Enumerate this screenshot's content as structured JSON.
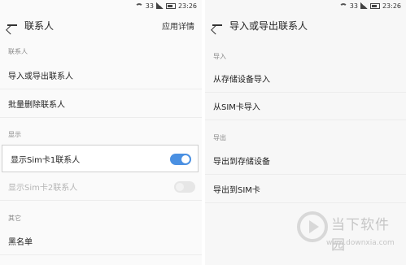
{
  "left": {
    "status": {
      "signal_text": "33",
      "time": "23:26"
    },
    "title": "联系人",
    "action": "应用详情",
    "sections": {
      "contacts": "联系人",
      "display": "显示",
      "other": "其它"
    },
    "items": {
      "import_export": "导入或导出联系人",
      "batch_delete": "批量删除联系人",
      "show_sim1": "显示Sim卡1联系人",
      "show_sim2": "显示Sim卡2联系人",
      "blacklist": "黑名单"
    },
    "toggles": {
      "show_sim1": true,
      "show_sim2": false
    }
  },
  "right": {
    "status": {
      "signal_text": "33",
      "time": "23:26"
    },
    "title": "导入或导出联系人",
    "sections": {
      "import": "导入",
      "export": "导出"
    },
    "items": {
      "import_storage": "从存储设备导入",
      "import_sim": "从SIM卡导入",
      "export_storage": "导出到存储设备",
      "export_sim": "导出到SIM卡"
    }
  },
  "watermark": {
    "name": "当下软件园",
    "url": "www.downxia.com"
  },
  "colors": {
    "accent": "#4a90e2"
  }
}
